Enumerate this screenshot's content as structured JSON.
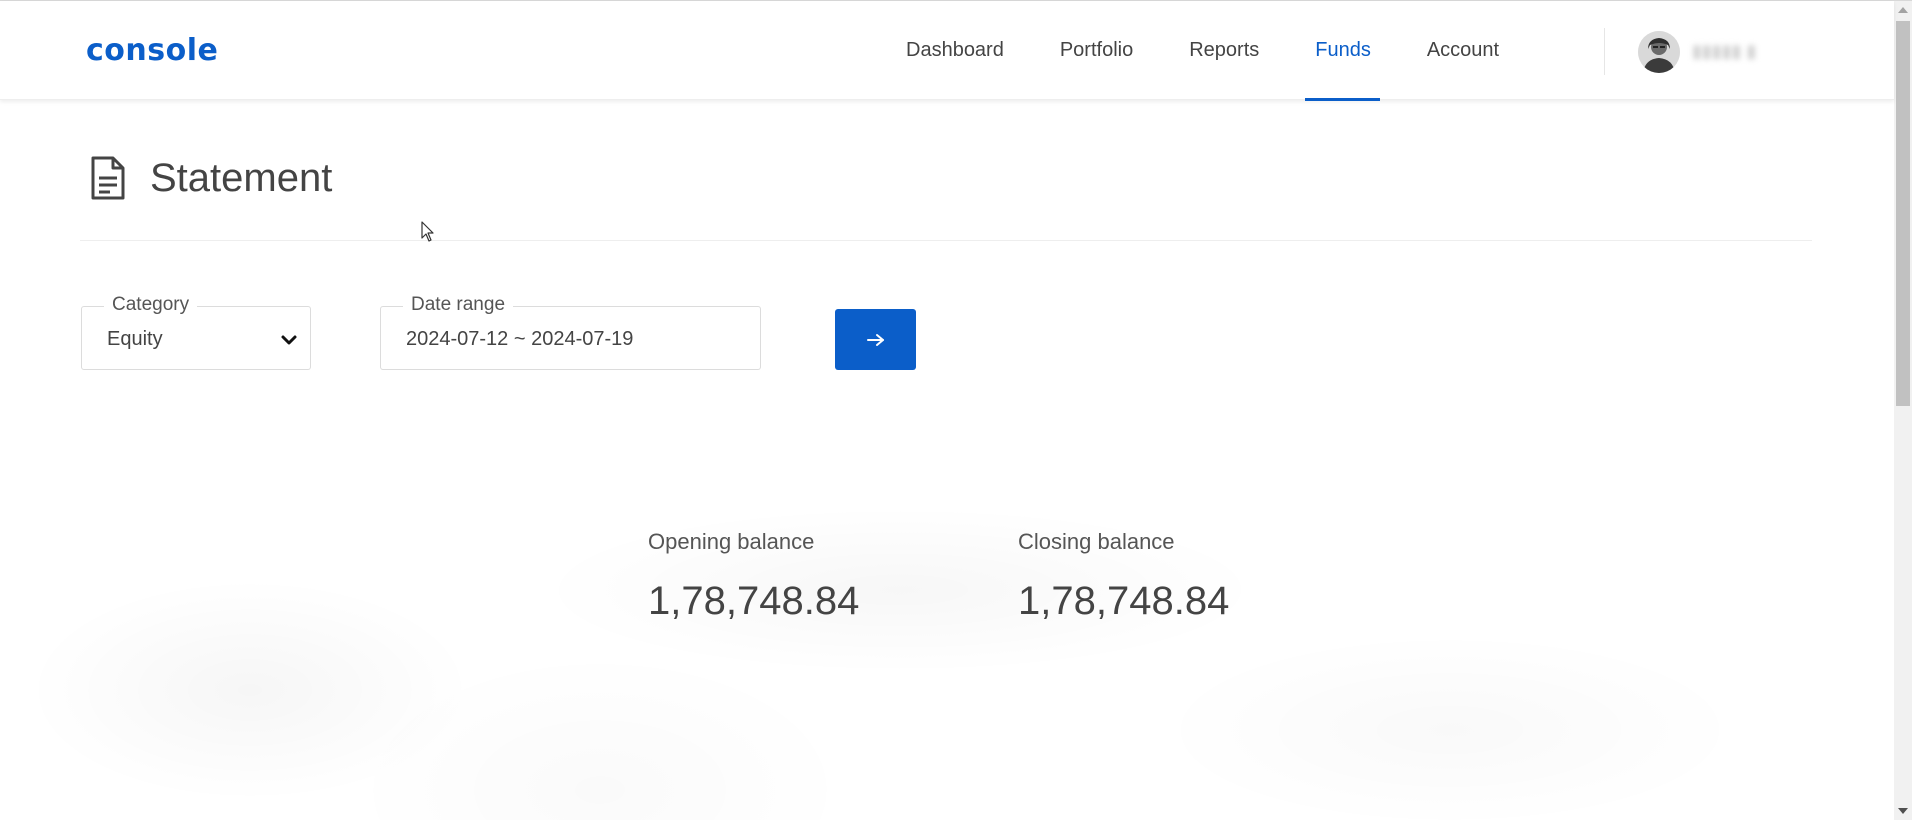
{
  "app": {
    "logo": "console"
  },
  "nav": {
    "items": [
      {
        "label": "Dashboard",
        "active": false
      },
      {
        "label": "Portfolio",
        "active": false
      },
      {
        "label": "Reports",
        "active": false
      },
      {
        "label": "Funds",
        "active": true
      },
      {
        "label": "Account",
        "active": false
      }
    ]
  },
  "user": {
    "avatar_icon": "user-avatar",
    "name_blurred": true
  },
  "page": {
    "title": "Statement",
    "title_icon": "document-icon"
  },
  "filters": {
    "category": {
      "label": "Category",
      "value": "Equity",
      "icon": "chevron-down-icon"
    },
    "date_range": {
      "label": "Date range",
      "value": "2024-07-12 ~ 2024-07-19"
    },
    "submit_icon": "arrow-right-icon"
  },
  "balances": {
    "opening": {
      "label": "Opening balance",
      "value": "1,78,748.84"
    },
    "closing": {
      "label": "Closing balance",
      "value": "1,78,748.84"
    }
  },
  "colors": {
    "accent": "#0b5ec9",
    "text": "#444444",
    "border": "#dcdcdc"
  }
}
